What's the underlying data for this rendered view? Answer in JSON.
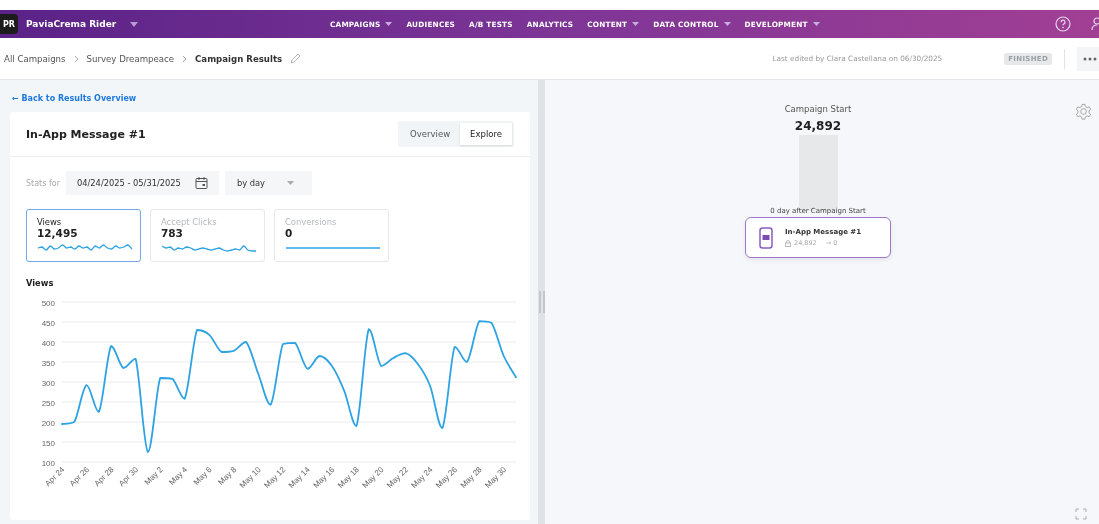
{
  "nav": {
    "logo": "PR",
    "app_name": "PaviaCrema Rider",
    "items": [
      {
        "label": "CAMPAIGNS",
        "dropdown": true
      },
      {
        "label": "AUDIENCES",
        "dropdown": false
      },
      {
        "label": "A/B TESTS",
        "dropdown": false
      },
      {
        "label": "ANALYTICS",
        "dropdown": false
      },
      {
        "label": "CONTENT",
        "dropdown": true
      },
      {
        "label": "DATA CONTROL",
        "dropdown": true
      },
      {
        "label": "DEVELOPMENT",
        "dropdown": true
      }
    ]
  },
  "breadcrumb": {
    "items": [
      "All Campaigns",
      "Survey Dreampeace",
      "Campaign Results"
    ],
    "last_edited": "Last edited by Clara Castellana on 06/30/2025",
    "status": "FINISHED"
  },
  "back_link": "← Back to Results Overview",
  "card": {
    "title": "In-App Message #1",
    "tabs": [
      {
        "label": "Overview",
        "selected": false
      },
      {
        "label": "Explore",
        "selected": true
      }
    ],
    "stats_label": "Stats for",
    "date_range": "04/24/2025 - 05/31/2025",
    "interval": "by day",
    "metrics": [
      {
        "label": "Views",
        "value": "12,495",
        "selected": true
      },
      {
        "label": "Accept Clicks",
        "value": "783",
        "selected": false
      },
      {
        "label": "Conversions",
        "value": "0",
        "selected": false
      }
    ],
    "chart_data": {
      "type": "line",
      "title": "Views",
      "categories": [
        "Apr 24",
        null,
        "Apr 26",
        null,
        "Apr 28",
        null,
        "Apr 30",
        null,
        "May 2",
        null,
        "May 4",
        null,
        "May 6",
        null,
        "May 8",
        null,
        "May 10",
        null,
        "May 12",
        null,
        "May 14",
        null,
        "May 16",
        null,
        "May 18",
        null,
        "May 20",
        null,
        "May 22",
        null,
        "May 24",
        null,
        "May 26",
        null,
        "May 28",
        null,
        "May 30",
        null
      ],
      "series": [
        {
          "color": "#2ea3e3",
          "values": [
            195,
            200,
            292,
            225,
            390,
            335,
            358,
            125,
            310,
            308,
            258,
            430,
            418,
            375,
            378,
            400,
            320,
            243,
            395,
            398,
            333,
            365,
            340,
            278,
            190,
            432,
            340,
            360,
            372,
            345,
            290,
            185,
            388,
            350,
            452,
            448,
            365,
            312
          ]
        }
      ],
      "ylim": [
        100,
        500
      ],
      "grid": true,
      "yticks": [
        100,
        150,
        200,
        250,
        300,
        350,
        400,
        450,
        500
      ]
    }
  },
  "flow": {
    "start_label": "Campaign Start",
    "start_count": "24,892",
    "delay": "0 day after Campaign Start",
    "node": {
      "title": "In-App Message #1",
      "audience": "24,892",
      "conversions": "→ 0"
    }
  }
}
